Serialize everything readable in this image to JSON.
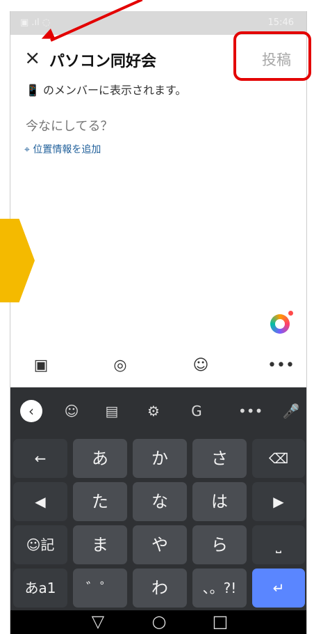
{
  "status": {
    "time": "15:46"
  },
  "header": {
    "close": "×",
    "title": "パソコン同好会",
    "post": "投稿"
  },
  "members_note": "のメンバーに表示されます。",
  "input": {
    "placeholder": "今なにしてる？",
    "value": ""
  },
  "location_link": "位置情報を追加",
  "toolbar": {
    "items": [
      "▣",
      "◎",
      "☺",
      "•••"
    ]
  },
  "keyboard": {
    "suggest": [
      "‹",
      "☺",
      "▤",
      "⚙",
      "G",
      "•••",
      "🎤"
    ],
    "rows": [
      [
        "←",
        "あ",
        "か",
        "さ",
        "⌫"
      ],
      [
        "◀",
        "た",
        "な",
        "は",
        "▶"
      ],
      [
        "☺記",
        "ま",
        "や",
        "ら",
        "⎵"
      ],
      [
        "あa1",
        "゛゜",
        "わ",
        "、。?!",
        "↵"
      ]
    ]
  },
  "nav": {
    "back": "▽",
    "home": "○",
    "recent": "□"
  }
}
